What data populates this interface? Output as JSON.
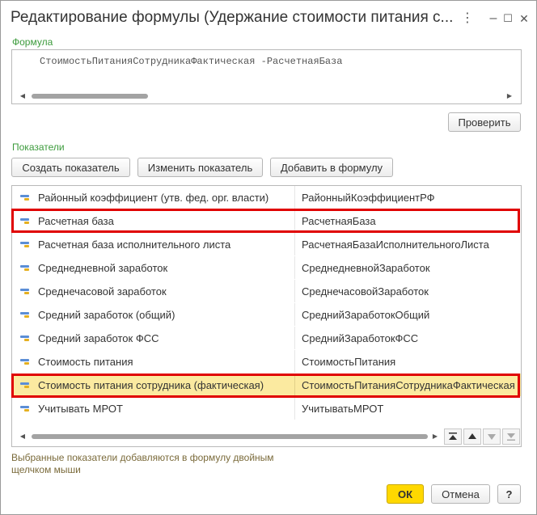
{
  "window": {
    "title": "Редактирование формулы (Удержание стоимости питания с...",
    "controls": {
      "more": "⋮",
      "minimize": "–",
      "maximize": "☐",
      "close": "✕"
    }
  },
  "formula": {
    "label": "Формула",
    "value": "СтоимостьПитанияСотрудникаФактическая -РасчетнаяБаза",
    "check_button": "Проверить"
  },
  "indicators": {
    "label": "Показатели",
    "buttons": {
      "create": "Создать показатель",
      "edit": "Изменить показатель",
      "add": "Добавить в формулу"
    },
    "rows": [
      {
        "name": "Районный коэффициент (утв. фед. орг. власти)",
        "code": "РайонныйКоэффициентРФ"
      },
      {
        "name": "Расчетная база",
        "code": "РасчетнаяБаза"
      },
      {
        "name": "Расчетная база исполнительного листа",
        "code": "РасчетнаяБазаИсполнительногоЛиста"
      },
      {
        "name": "Среднедневной заработок",
        "code": "СреднедневнойЗаработок"
      },
      {
        "name": "Среднечасовой заработок",
        "code": "СреднечасовойЗаработок"
      },
      {
        "name": "Средний заработок (общий)",
        "code": "СреднийЗаработокОбщий"
      },
      {
        "name": "Средний заработок ФСС",
        "code": "СреднийЗаработокФСС"
      },
      {
        "name": "Стоимость питания",
        "code": "СтоимостьПитания"
      },
      {
        "name": "Стоимость питания сотрудника (фактическая)",
        "code": "СтоимостьПитанияСотрудникаФактическая"
      },
      {
        "name": "Учитывать МРОТ",
        "code": "УчитыватьМРОТ"
      }
    ],
    "selected_row": 8,
    "hint": "Выбранные показатели добавляются в формулу двойным щелчком мыши"
  },
  "footer": {
    "ok": "ОК",
    "cancel": "Отмена",
    "help": "?"
  },
  "colors": {
    "accent_yellow": "#ffd800",
    "highlight_red": "#e00000",
    "selected_row": "#fbeaa0",
    "label_green": "#3c9b3c"
  }
}
